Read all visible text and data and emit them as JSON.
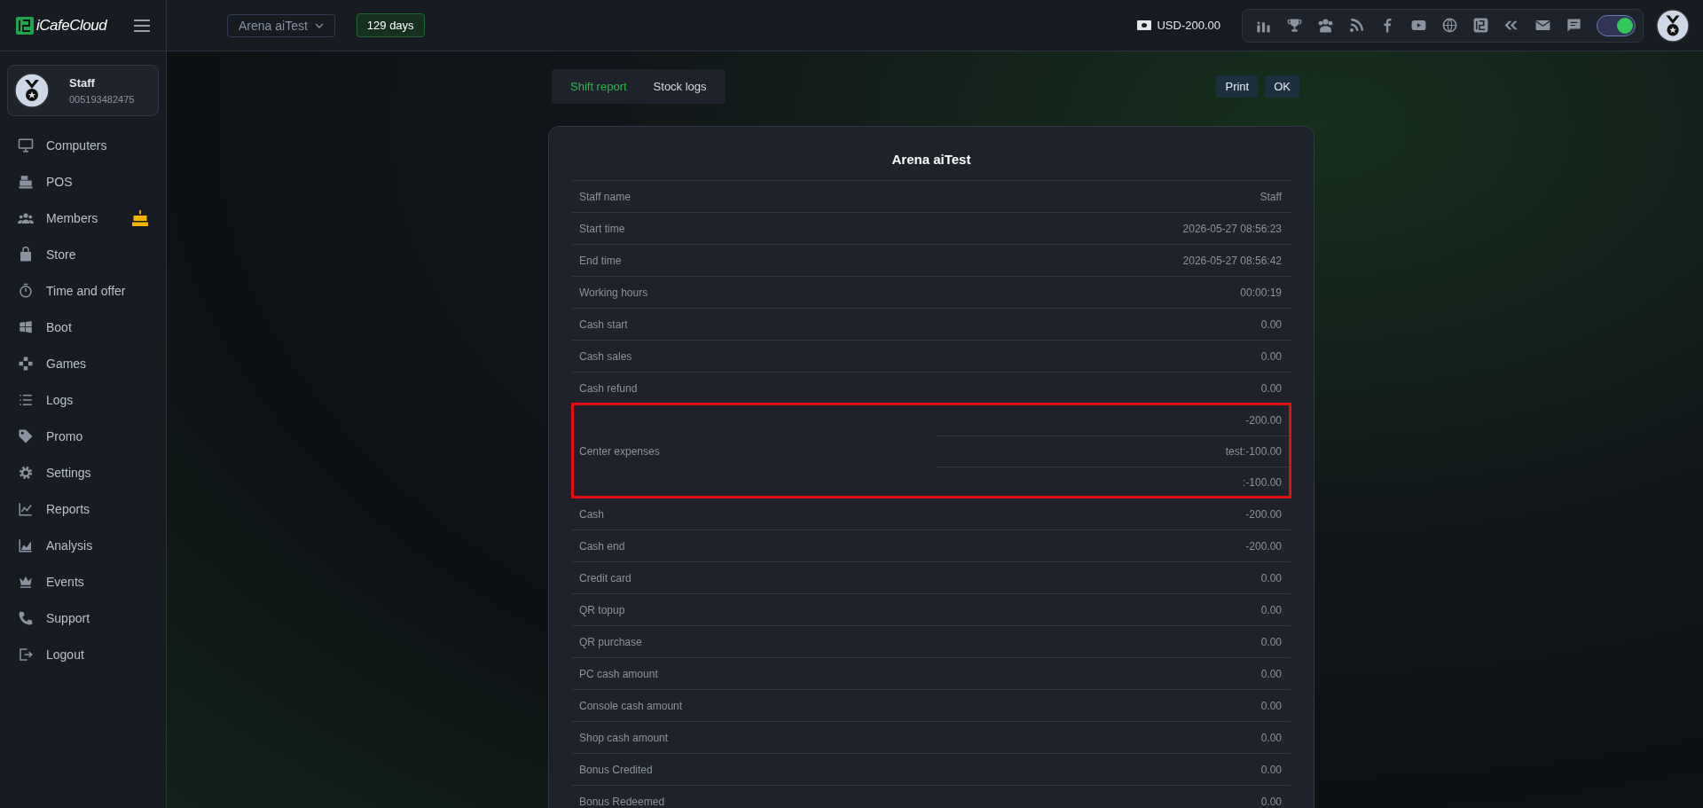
{
  "topbar": {
    "logo": "iCafeCloud",
    "branch_selector": "Arena aiTest",
    "license_badge": "129 days",
    "balance": "USD-200.00",
    "dark_mode_toggle": {
      "on": true
    }
  },
  "sidebar": {
    "profile": {
      "name": "Staff",
      "account_id": "005193482475"
    },
    "items": [
      {
        "label": "Computers",
        "badge": false
      },
      {
        "label": "POS",
        "badge": false
      },
      {
        "label": "Members",
        "badge": true
      },
      {
        "label": "Store",
        "badge": false
      },
      {
        "label": "Time and offer",
        "badge": false
      },
      {
        "label": "Boot",
        "badge": false
      },
      {
        "label": "Games",
        "badge": false
      },
      {
        "label": "Logs",
        "badge": false
      },
      {
        "label": "Promo",
        "badge": false
      },
      {
        "label": "Settings",
        "badge": false
      },
      {
        "label": "Reports",
        "badge": false
      },
      {
        "label": "Analysis",
        "badge": false
      },
      {
        "label": "Events",
        "badge": false
      },
      {
        "label": "Support",
        "badge": false
      },
      {
        "label": "Logout",
        "badge": false
      }
    ]
  },
  "tabs": [
    {
      "label": "Shift report",
      "selected": true
    },
    {
      "label": "Stock logs",
      "selected": false
    }
  ],
  "actions": [
    "Print",
    "OK"
  ],
  "report": {
    "title": "Arena aiTest",
    "rows": [
      {
        "label": "Staff name",
        "values": [
          "Staff"
        ],
        "highlighted": false
      },
      {
        "label": "Start time",
        "values": [
          "2026-05-27 08:56:23"
        ],
        "highlighted": false
      },
      {
        "label": "End time",
        "values": [
          "2026-05-27 08:56:42"
        ],
        "highlighted": false
      },
      {
        "label": "Working hours",
        "values": [
          "00:00:19"
        ],
        "highlighted": false
      },
      {
        "label": "Cash start",
        "values": [
          "0.00"
        ],
        "highlighted": false
      },
      {
        "label": "Cash sales",
        "values": [
          "0.00"
        ],
        "highlighted": false
      },
      {
        "label": "Cash refund",
        "values": [
          "0.00"
        ],
        "highlighted": false
      },
      {
        "label": "Center expenses",
        "values": [
          "-200.00",
          "test:-100.00",
          ":-100.00"
        ],
        "highlighted": true
      },
      {
        "label": "Cash",
        "values": [
          "-200.00"
        ],
        "highlighted": false
      },
      {
        "label": "Cash end",
        "values": [
          "-200.00"
        ],
        "highlighted": false
      },
      {
        "label": "Credit card",
        "values": [
          "0.00"
        ],
        "highlighted": false
      },
      {
        "label": "QR topup",
        "values": [
          "0.00"
        ],
        "highlighted": false
      },
      {
        "label": "QR purchase",
        "values": [
          "0.00"
        ],
        "highlighted": false
      },
      {
        "label": "PC cash amount",
        "values": [
          "0.00"
        ],
        "highlighted": false
      },
      {
        "label": "Console cash amount",
        "values": [
          "0.00"
        ],
        "highlighted": false
      },
      {
        "label": "Shop cash amount",
        "values": [
          "0.00"
        ],
        "highlighted": false
      },
      {
        "label": "Bonus Credited",
        "values": [
          "0.00"
        ],
        "highlighted": false
      },
      {
        "label": "Bonus Redeemed",
        "values": [
          "0.00"
        ],
        "highlighted": false
      }
    ]
  }
}
